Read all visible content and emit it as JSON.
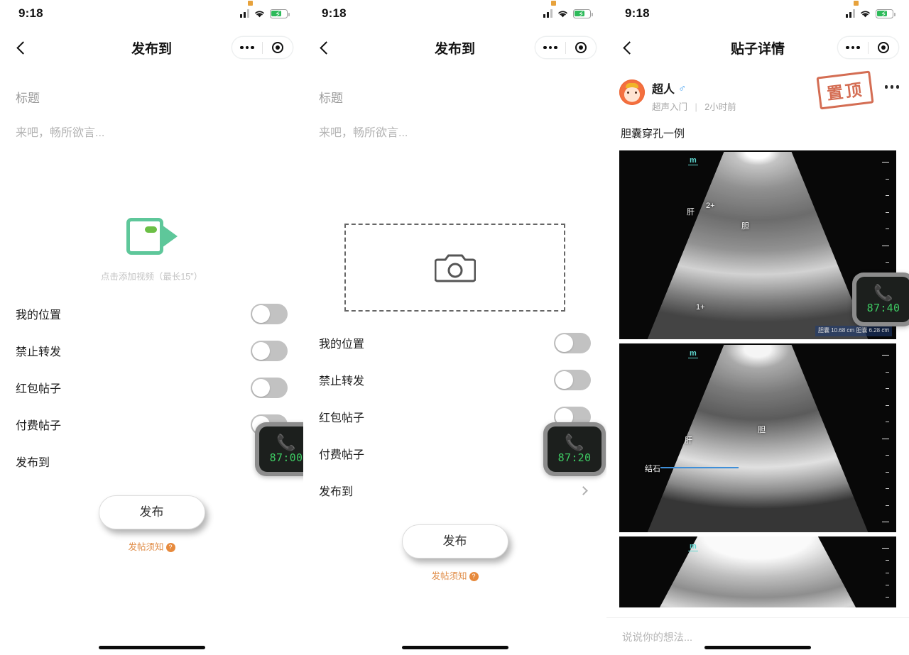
{
  "status_bar": {
    "time": "9:18",
    "battery_state": "charging",
    "signal_bars": 3,
    "wifi": "wifi-icon"
  },
  "panel1": {
    "nav": {
      "title": "发布到",
      "back": "back-chevron",
      "more": "more-dots",
      "target": "target-icon"
    },
    "compose": {
      "title_placeholder": "标题",
      "body_placeholder": "来吧，畅所欲言..."
    },
    "media": {
      "icon": "video-camera-icon",
      "hint": "点击添加视频（最长15\"）"
    },
    "options": [
      {
        "label": "我的位置",
        "control": "toggle",
        "on": false
      },
      {
        "label": "禁止转发",
        "control": "toggle",
        "on": false
      },
      {
        "label": "红包帖子",
        "control": "toggle",
        "on": false
      },
      {
        "label": "付费帖子",
        "control": "toggle",
        "on": false
      },
      {
        "label": "发布到",
        "control": "chevron"
      }
    ],
    "publish": {
      "label": "发布",
      "note": "发帖须知",
      "note_badge": "?"
    },
    "call_widget": {
      "time": "87:00",
      "icon": "phone-icon"
    }
  },
  "panel2": {
    "nav": {
      "title": "发布到",
      "back": "back-chevron",
      "more": "more-dots",
      "target": "target-icon"
    },
    "compose": {
      "title_placeholder": "标题",
      "body_placeholder": "来吧，畅所欲言..."
    },
    "media": {
      "icon": "camera-icon"
    },
    "options": [
      {
        "label": "我的位置",
        "control": "toggle",
        "on": false
      },
      {
        "label": "禁止转发",
        "control": "toggle",
        "on": false
      },
      {
        "label": "红包帖子",
        "control": "toggle",
        "on": false
      },
      {
        "label": "付费帖子",
        "control": "toggle",
        "on": false
      },
      {
        "label": "发布到",
        "control": "chevron"
      }
    ],
    "publish": {
      "label": "发布",
      "note": "发帖须知",
      "note_badge": "?"
    },
    "call_widget": {
      "time": "87:20",
      "icon": "phone-icon"
    }
  },
  "panel3": {
    "nav": {
      "title": "贴子详情",
      "back": "back-chevron",
      "more": "more-dots",
      "target": "target-icon"
    },
    "post": {
      "author": "超人",
      "gender": "♂",
      "board": "超声入门",
      "separator": "|",
      "timestamp": "2小时前",
      "stamp": "置顶",
      "title": "胆囊穿孔一例"
    },
    "images": [
      {
        "name": "ultrasound-gallbladder-1",
        "corner_mark": "m",
        "labels": [
          "肝",
          "胆"
        ],
        "caliper_1": "1+",
        "caliper_2": "2+",
        "measurements": "胆囊  10.68 cm\n胆囊   6.28 cm"
      },
      {
        "name": "ultrasound-gallbladder-2",
        "corner_mark": "m",
        "labels": [
          "肝",
          "胆",
          "结石"
        ],
        "annotation_line": "pointer-to-stone"
      },
      {
        "name": "ultrasound-gallbladder-3",
        "corner_mark": "m",
        "labels": []
      }
    ],
    "comment": {
      "placeholder": "说说你的想法..."
    },
    "call_widget": {
      "time": "87:40",
      "icon": "phone-icon"
    }
  },
  "colors": {
    "accent_green": "#5ec79a",
    "call_green": "#3ecb63",
    "stamp_red": "#cf5a3c",
    "note_orange": "#e08d48",
    "gender_blue": "#4aa3f0"
  }
}
